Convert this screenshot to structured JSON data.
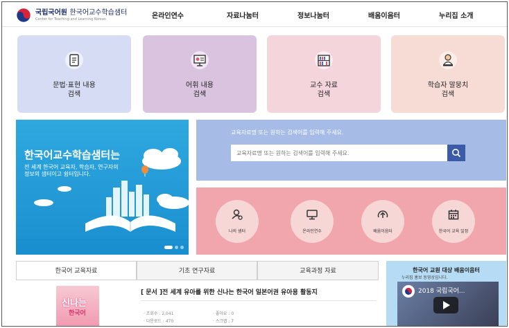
{
  "header": {
    "logo_main": "국립국어원",
    "logo_main2": "한국어교수학습샘터",
    "logo_sub": "Center for Teaching and Learning Korean",
    "nav": [
      "온라인연수",
      "자료나눔터",
      "정보나눔터",
      "배움이음터",
      "누리집 소개"
    ]
  },
  "cards": [
    {
      "line1": "문법·표현 내용",
      "line2": "검색",
      "color": "#d6dcf3",
      "icon": "document-list-icon"
    },
    {
      "line1": "어휘 내용",
      "line2": "검색",
      "color": "#dac3df",
      "icon": "presentation-board-icon"
    },
    {
      "line1": "교수 자료",
      "line2": "검색",
      "color": "#f5d5dc",
      "icon": "bookshelf-icon"
    },
    {
      "line1": "학습자 말뭉치",
      "line2": "검색",
      "color": "#f6dcd5",
      "icon": "learner-at-desk-icon"
    }
  ],
  "banner": {
    "title": "한국어교수학습샘터는",
    "sub1": "전 세계 한국어 교육자, 학습자, 연구자의",
    "sub2": "정보의 샘터이고 쉼터입니다."
  },
  "search": {
    "hint": "교육자료명 또는 원하는 검색어를 입력해 주세요.",
    "placeholder": "교육자료명 또는 원하는 검색어를 입력해 주세요."
  },
  "quick_links": [
    {
      "label": "나의 샘터",
      "icon": "my-page-icon"
    },
    {
      "label": "온라인연수",
      "icon": "monitor-icon"
    },
    {
      "label": "배움이음터",
      "icon": "upload-arrow-icon"
    },
    {
      "label": "한국어 교육 일정",
      "icon": "calendar-icon"
    }
  ],
  "tabs": [
    "한국어 교육자료",
    "기초 연구자료",
    "교육과정 자료"
  ],
  "featured": {
    "book_title": "신나는",
    "book_sub": "한국어",
    "doc_title": "[ 문서 ]전 세계 유아를 위한 신나는 한국어 일본어권 유아용 활동지",
    "views": "· 조회수 : 2,041",
    "likes": "· 좋아요 : 0",
    "downloads": "· 다운로드 : 470",
    "scraps": "· 스크랩 : 7"
  },
  "video": {
    "title": "한국어 교원 대상 배움이음터",
    "sub": "누리집 홍보 동영상입니다.",
    "thumb_title": "2018 국립국어..."
  },
  "colors": {
    "banner": "#1a8fd0",
    "search_panel": "#a6bce6",
    "quick_panel": "#f0a6ac",
    "video_panel": "#b6dcf5",
    "search_button": "#3b5aa8"
  }
}
